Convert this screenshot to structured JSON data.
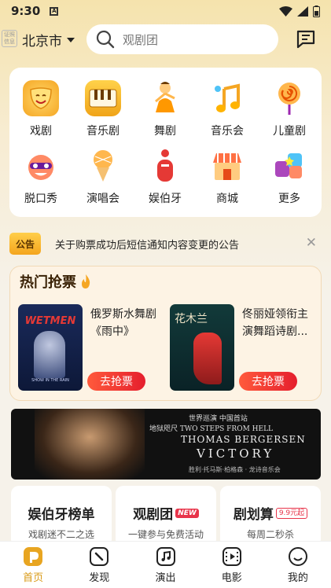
{
  "status": {
    "time": "9:30",
    "notif_letter": "A"
  },
  "header": {
    "badge": "证照信息",
    "city": "北京市",
    "search_placeholder": "观剧团"
  },
  "categories": [
    {
      "label": "戏剧",
      "icon": "drama-mask-icon"
    },
    {
      "label": "音乐剧",
      "icon": "piano-keys-icon"
    },
    {
      "label": "舞剧",
      "icon": "dancer-icon"
    },
    {
      "label": "音乐会",
      "icon": "music-note-icon"
    },
    {
      "label": "儿童剧",
      "icon": "lollipop-icon"
    },
    {
      "label": "脱口秀",
      "icon": "comedy-face-icon"
    },
    {
      "label": "演唱会",
      "icon": "microphone-icon"
    },
    {
      "label": "娱伯牙",
      "icon": "yuboya-logo-icon"
    },
    {
      "label": "商城",
      "icon": "shop-icon"
    },
    {
      "label": "更多",
      "icon": "more-grid-icon"
    }
  ],
  "notice": {
    "tag": "公告",
    "text": "关于购票成功后短信通知内容变更的公告"
  },
  "hot": {
    "title": "热门抢票",
    "items": [
      {
        "name": "俄罗斯水舞剧《雨中》",
        "button": "去抢票",
        "poster_text": "WETMEN",
        "poster_sub": "SHOW IN THE RAIN"
      },
      {
        "name": "佟丽娅领衔主演舞蹈诗剧...",
        "button": "去抢票",
        "poster_text": "花木兰"
      }
    ]
  },
  "banner": {
    "line1": "世界巡演 中国首站",
    "line2": "地狱咫尺  TWO STEPS FROM HELL",
    "line3": "THOMAS BERGERSEN",
    "line4": "VICTORY",
    "line5": "胜利·托马斯·柏格森 · 龙诗音乐会"
  },
  "features": [
    {
      "title": "娱伯牙榜单",
      "sub": "戏剧迷不二之选",
      "pill": ""
    },
    {
      "title": "观剧团",
      "sub": "一键参与免费活动",
      "pill": "NEW"
    },
    {
      "title": "剧划算",
      "sub": "每周二秒杀",
      "pill": "9.9元起"
    }
  ],
  "tabs": [
    {
      "label": "首页",
      "active": true
    },
    {
      "label": "发现",
      "active": false
    },
    {
      "label": "演出",
      "active": false
    },
    {
      "label": "电影",
      "active": false
    },
    {
      "label": "我的",
      "active": false
    }
  ],
  "colors": {
    "accent": "#d99a16",
    "buy": "#e51e2d",
    "header_bg": "#f5e3ad"
  }
}
